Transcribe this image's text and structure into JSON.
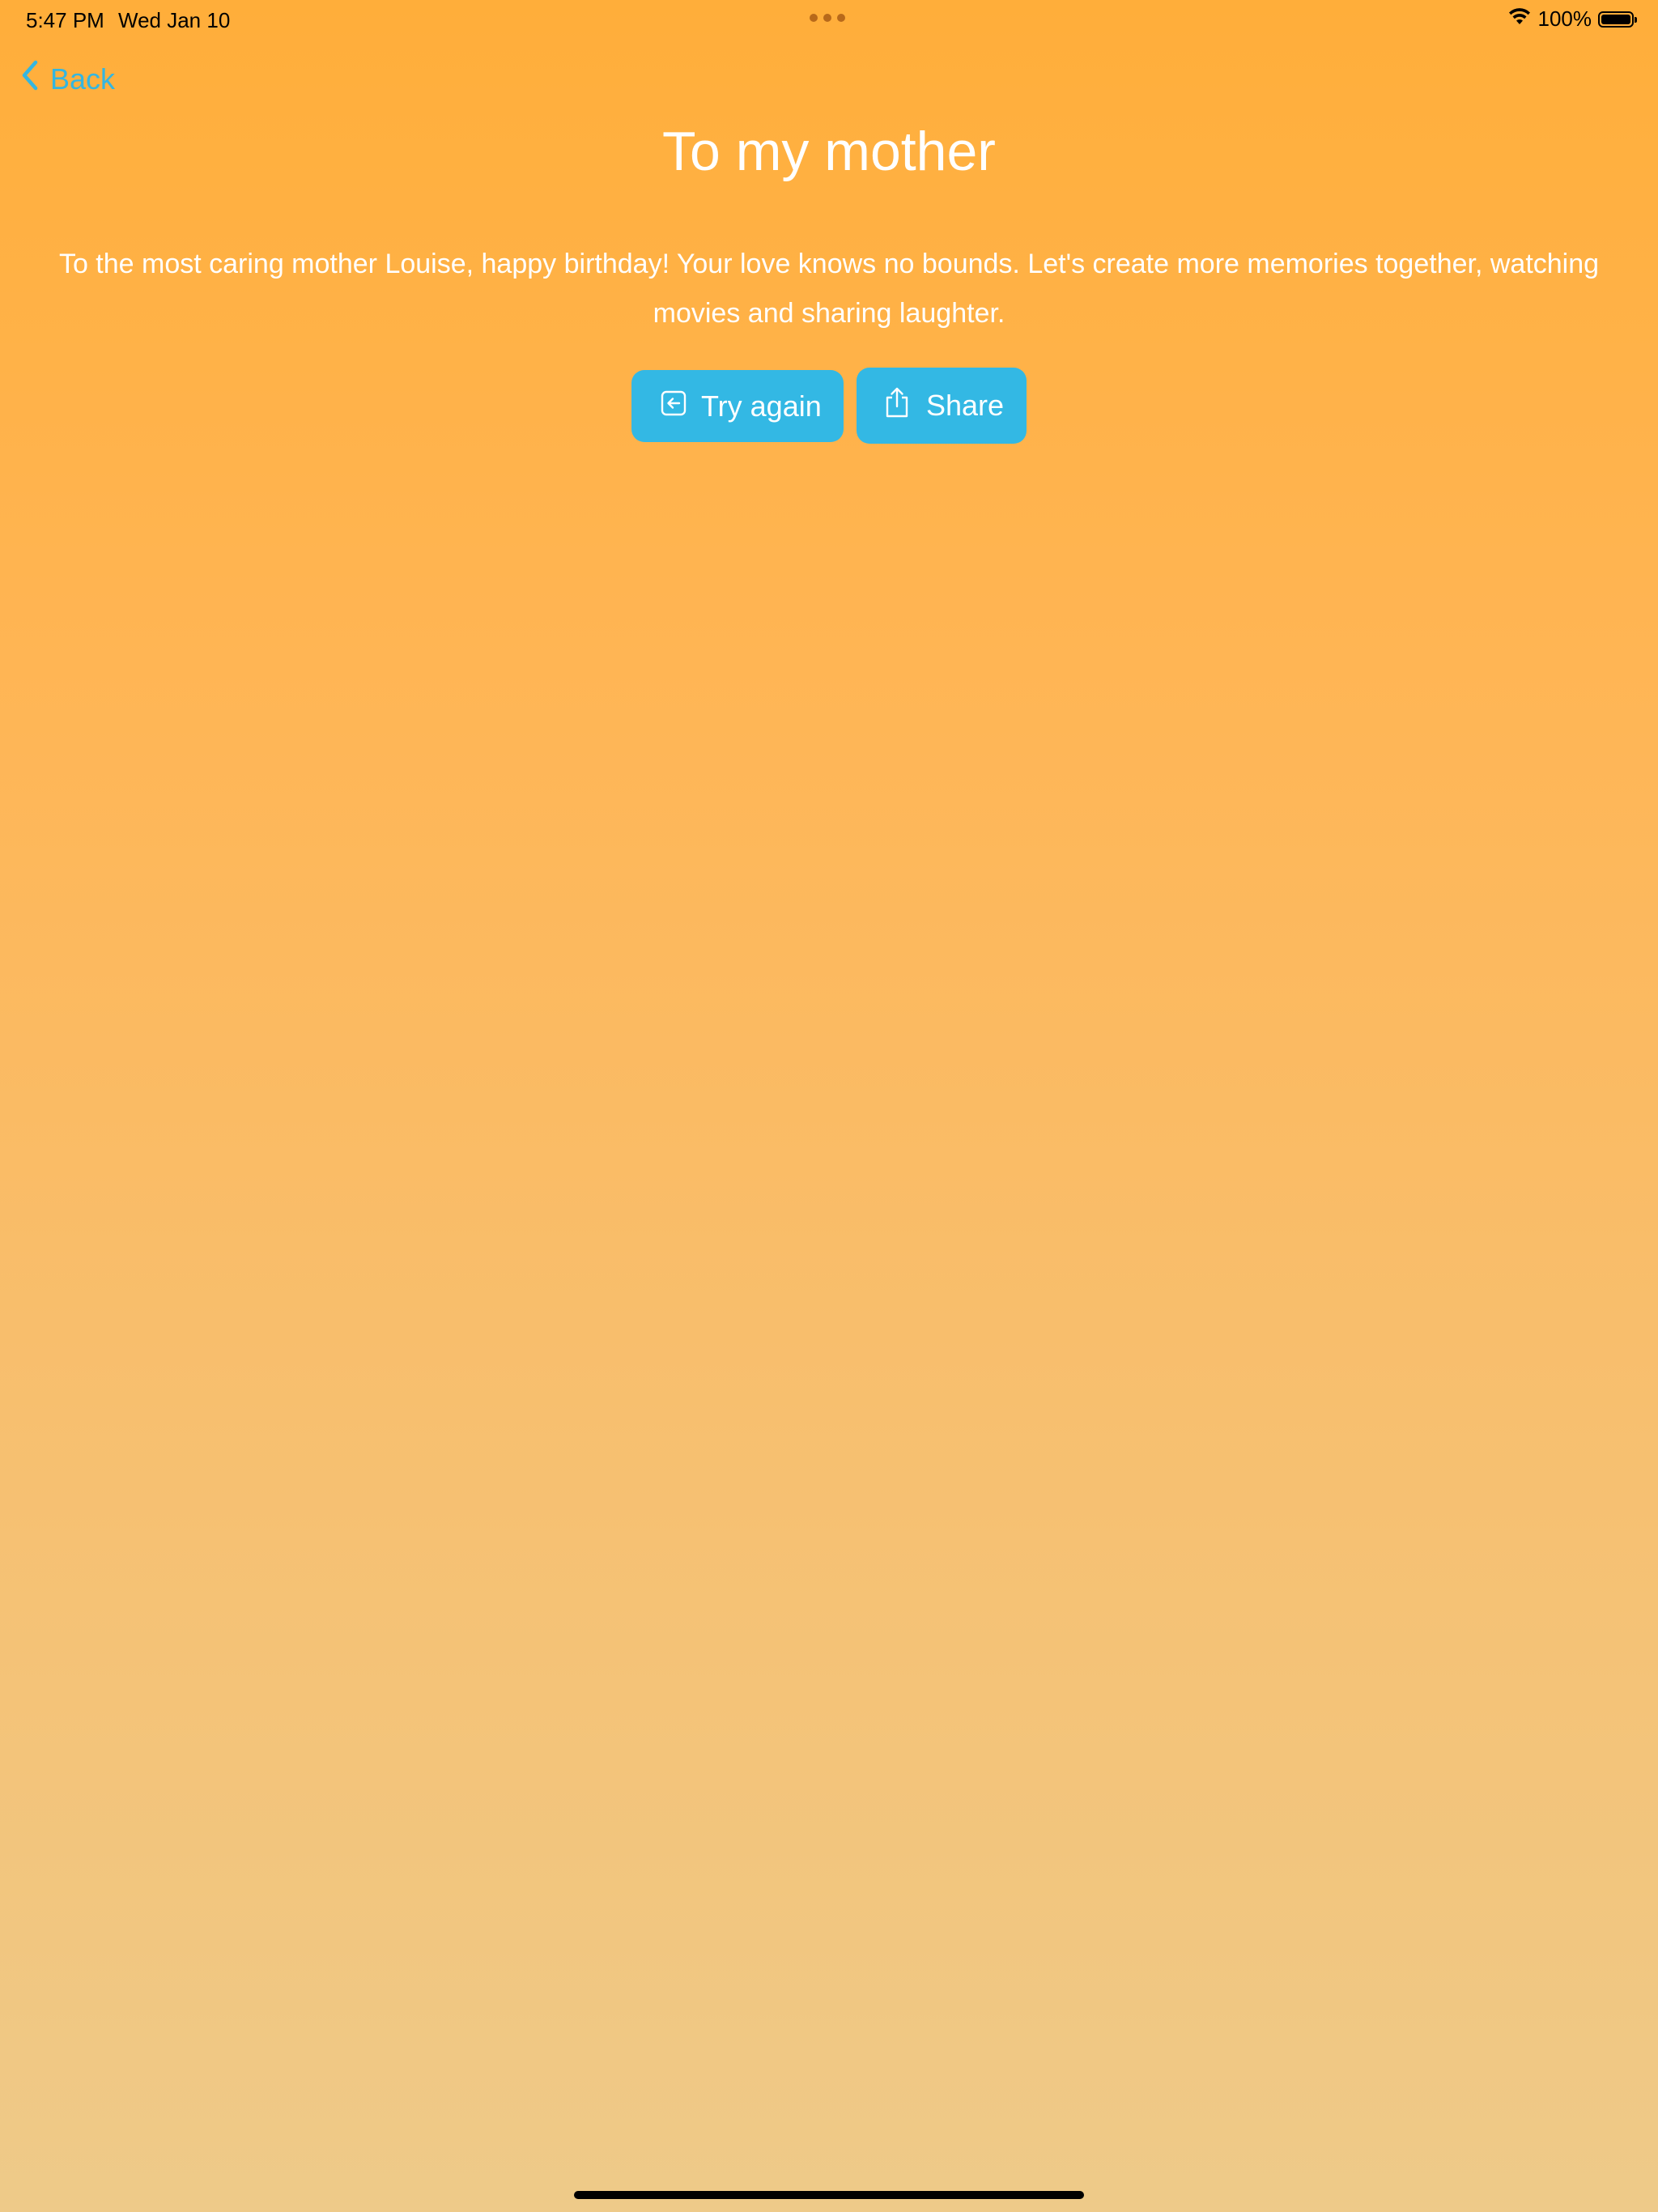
{
  "status_bar": {
    "time": "5:47 PM",
    "date": "Wed Jan 10",
    "battery_percent": "100%",
    "battery_level": 1.0
  },
  "nav": {
    "back_label": "Back"
  },
  "content": {
    "title": "To my mother",
    "message": "To the most caring mother Louise, happy birthday! Your love knows no bounds. Let's create more memories together, watching movies and sharing laughter."
  },
  "actions": {
    "try_again_label": "Try again",
    "share_label": "Share"
  },
  "icons": {
    "back": "chevron-left-icon",
    "try_again": "arrow-left-square-icon",
    "share": "share-icon",
    "wifi": "wifi-icon",
    "battery": "battery-icon"
  },
  "colors": {
    "accent": "#33B8E4",
    "back_link": "#34B6E0",
    "background_top": "#FFAE3A",
    "background_bottom": "#EECA89",
    "text": "#FFFFFF"
  }
}
